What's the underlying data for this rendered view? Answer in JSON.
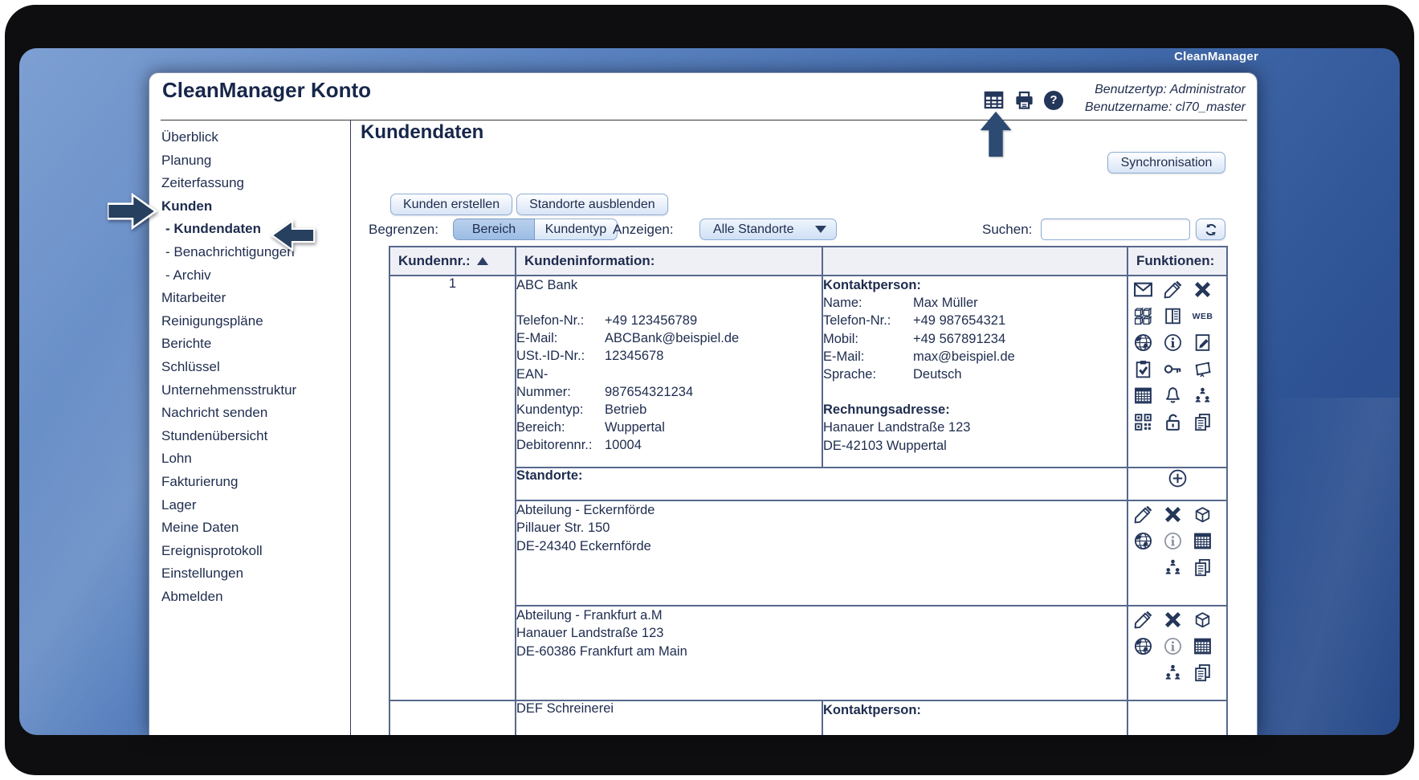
{
  "brand": "CleanManager",
  "window": {
    "title": "CleanManager Konto",
    "user_type": "Benutzertyp: Administrator",
    "user_name": "Benutzername: cl70_master",
    "header_icons": [
      "spreadsheet-icon",
      "printer-icon",
      "help-icon"
    ],
    "help_glyph": "?"
  },
  "sidebar": {
    "items": [
      {
        "label": "Überblick"
      },
      {
        "label": "Planung"
      },
      {
        "label": "Zeiterfassung"
      },
      {
        "label": "Kunden",
        "bold": true
      },
      {
        "label": "- Kundendaten",
        "bold": true,
        "sub": true
      },
      {
        "label": "- Benachrichtigungen",
        "sub": true
      },
      {
        "label": "- Archiv",
        "sub": true
      },
      {
        "label": "Mitarbeiter"
      },
      {
        "label": "Reinigungspläne"
      },
      {
        "label": "Berichte"
      },
      {
        "label": "Schlüssel"
      },
      {
        "label": "Unternehmensstruktur"
      },
      {
        "label": "Nachricht senden"
      },
      {
        "label": "Stundenübersicht"
      },
      {
        "label": "Lohn"
      },
      {
        "label": "Fakturierung"
      },
      {
        "label": "Lager"
      },
      {
        "label": "Meine Daten"
      },
      {
        "label": "Ereignisprotokoll"
      },
      {
        "label": "Einstellungen"
      },
      {
        "label": "Abmelden"
      }
    ]
  },
  "main": {
    "heading": "Kundendaten",
    "sync_button": "Synchronisation",
    "create_button": "Kunden erstellen",
    "toggle_sites_button": "Standorte ausblenden",
    "limit_label": "Begrenzen:",
    "limit_area_button": "Bereich",
    "limit_type_button": "Kundentyp",
    "show_label": "Anzeigen:",
    "show_value": "Alle Standorte",
    "search_label": "Suchen:",
    "search_value": ""
  },
  "table": {
    "col_number": "Kundennr.:",
    "col_info": "Kundeninformation:",
    "col_functions": "Funktionen:",
    "customer": {
      "number": "1",
      "name": "ABC Bank",
      "info_rows": [
        {
          "label": "Telefon-Nr.:",
          "value": "+49 123456789"
        },
        {
          "label": "E-Mail:",
          "value": "ABCBank@beispiel.de"
        },
        {
          "label": "USt.-ID-Nr.:",
          "value": "12345678"
        },
        {
          "label": "EAN-",
          "value": ""
        },
        {
          "label": "Nummer:",
          "value": "987654321234"
        },
        {
          "label": "Kundentyp:",
          "value": "Betrieb"
        },
        {
          "label": "Bereich:",
          "value": "Wuppertal"
        },
        {
          "label": "Debitorennr.:",
          "value": "10004"
        }
      ],
      "contact_heading": "Kontaktperson:",
      "contact_rows": [
        {
          "label": "Name:",
          "value": "Max Müller"
        },
        {
          "label": "Telefon-Nr.:",
          "value": "+49 987654321"
        },
        {
          "label": "Mobil:",
          "value": "+49 567891234"
        },
        {
          "label": "E-Mail:",
          "value": "max@beispiel.de"
        },
        {
          "label": "Sprache:",
          "value": "Deutsch"
        }
      ],
      "billing_heading": "Rechnungsadresse:",
      "billing_lines": [
        "Hanauer Landstraße 123",
        "DE-42103 Wuppertal"
      ],
      "web_label": "WEB",
      "function_icons": [
        "mail",
        "edit",
        "delete",
        "boxes",
        "catalog",
        "web",
        "globe",
        "info",
        "note-edit",
        "clipboard-check",
        "key",
        "plan-board",
        "spreadsheet",
        "bell",
        "org-chart",
        "qr-code",
        "unlock",
        "copy"
      ],
      "sites_heading": "Standorte:",
      "site_add_icon": "add-circle",
      "site_function_icons": [
        "edit",
        "delete",
        "cube",
        "globe",
        "info",
        "spreadsheet",
        "org-chart",
        "copy"
      ],
      "sites": [
        {
          "lines": [
            "Abteilung - Eckernförde",
            "Pillauer Str. 150",
            "DE-24340 Eckernförde"
          ]
        },
        {
          "lines": [
            "Abteilung - Frankfurt a.M",
            "Hanauer Landstraße 123",
            "DE-60386 Frankfurt am Main"
          ]
        }
      ]
    },
    "next_partial": {
      "info": "DEF Schreinerei",
      "contact_heading": "Kontaktperson:"
    }
  }
}
